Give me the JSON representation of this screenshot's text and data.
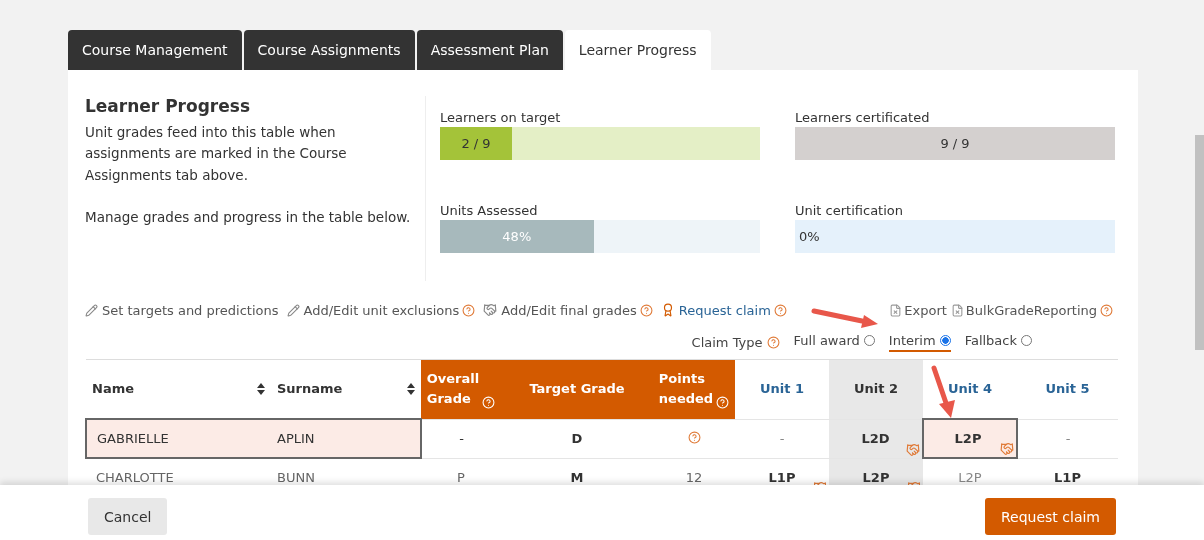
{
  "tabs": [
    {
      "label": "Course Management",
      "selected": false
    },
    {
      "label": "Course Assignments",
      "selected": false
    },
    {
      "label": "Assessment Plan",
      "selected": false
    },
    {
      "label": "Learner Progress",
      "selected": true
    }
  ],
  "intro": {
    "title": "Learner Progress",
    "paragraphs": [
      "Unit grades feed into this table when assignments are marked in the Course Assignments tab above.",
      "Manage grades and progress in the table below."
    ]
  },
  "stats": [
    {
      "label": "Learners on target",
      "reading": "2 / 9",
      "level": 0.225,
      "kind": "green"
    },
    {
      "label": "Learners certificated",
      "reading": "9 / 9",
      "level": 1,
      "kind": "grey"
    },
    {
      "label": "Units Assessed",
      "reading": "48%",
      "level": 0.48,
      "kind": "slate"
    },
    {
      "label": "Unit certification",
      "reading": "0%",
      "kind": "blue"
    }
  ],
  "actions": [
    {
      "label": "Set targets and predictions",
      "kind": "edit",
      "help": false
    },
    {
      "label": "Add/Edit unit exclusions",
      "kind": "edit",
      "help": true
    },
    {
      "label": "Add/Edit final grades",
      "kind": "final",
      "help": true
    },
    {
      "label": "Request claim",
      "kind": "claim",
      "help": true
    }
  ],
  "exports": [
    {
      "label": "Export",
      "help": false
    },
    {
      "label": "BulkGradeReporting",
      "help": true
    }
  ],
  "claim_type": {
    "label": "Claim Type",
    "options": [
      {
        "label": "Full award",
        "selected": false
      },
      {
        "label": "Interim",
        "selected": true
      },
      {
        "label": "Fallback",
        "selected": false
      }
    ]
  },
  "table": {
    "columns": [
      {
        "label": "Name",
        "kind": "sortable"
      },
      {
        "label": "Surname",
        "kind": "sortable"
      },
      {
        "label": "Overall Grade",
        "kind": "summary",
        "help": true
      },
      {
        "label": "Target Grade",
        "kind": "summary",
        "help": false
      },
      {
        "label": "Points needed",
        "kind": "summary",
        "help": true
      },
      {
        "label": "Unit 1",
        "kind": "unit",
        "shaded": false
      },
      {
        "label": "Unit 2",
        "kind": "unit",
        "shaded": true
      },
      {
        "label": "Unit 4",
        "kind": "unit",
        "shaded": false
      },
      {
        "label": "Unit 5",
        "kind": "unit",
        "shaded": false
      }
    ],
    "rows": [
      {
        "name": "GABRIELLE",
        "surname": "APLIN",
        "selected": true,
        "overall": "-",
        "target": "D",
        "points_help": true,
        "units": [
          {
            "grade": "-",
            "bold": false,
            "final": false,
            "selected": false
          },
          {
            "grade": "L2D",
            "bold": true,
            "final": true,
            "selected": false
          },
          {
            "grade": "L2P",
            "bold": true,
            "final": true,
            "selected": true
          },
          {
            "grade": "-",
            "bold": false,
            "final": false,
            "selected": false
          }
        ]
      },
      {
        "name": "CHARLOTTE",
        "surname": "BUNN",
        "selected": false,
        "overall": "P",
        "target": "M",
        "points": "12",
        "points_help": false,
        "units": [
          {
            "grade": "L1P",
            "bold": true,
            "final": true,
            "selected": false
          },
          {
            "grade": "L2P",
            "bold": true,
            "final": true,
            "selected": false
          },
          {
            "grade": "L2P",
            "bold": false,
            "final": false,
            "selected": false
          },
          {
            "grade": "L1P",
            "bold": true,
            "final": false,
            "selected": false
          }
        ]
      }
    ]
  },
  "footer": {
    "cancel": "Cancel",
    "submit": "Request claim"
  }
}
